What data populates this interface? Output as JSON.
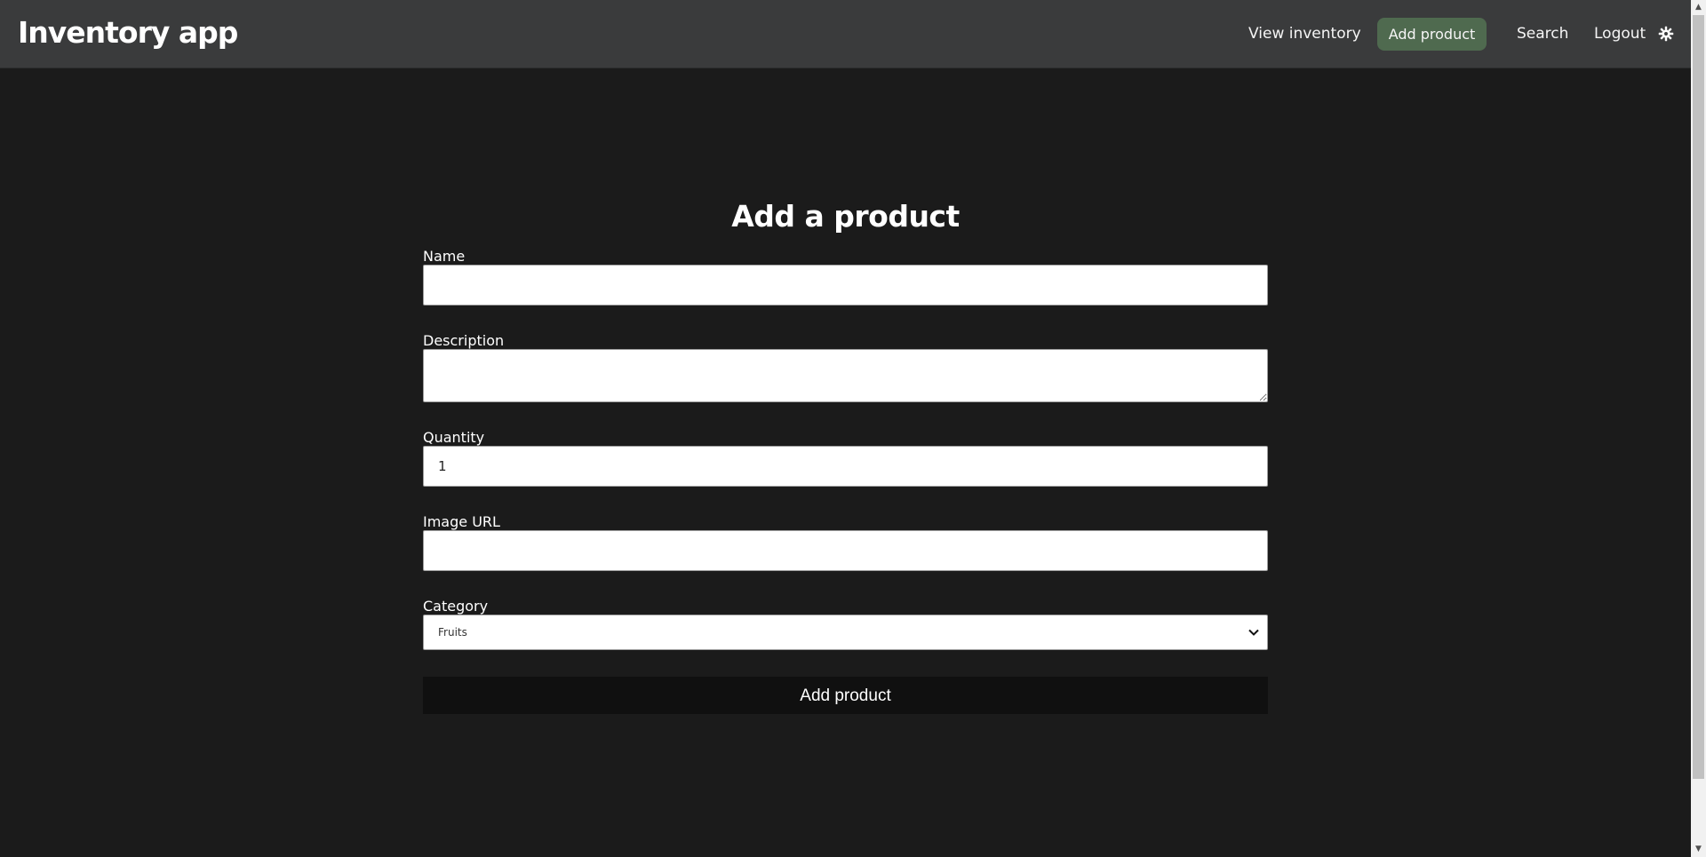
{
  "app": {
    "title": "Inventory app"
  },
  "nav": {
    "items": [
      {
        "label": "View inventory",
        "active": false
      },
      {
        "label": "Add product",
        "active": true
      },
      {
        "label": "Search",
        "active": false
      },
      {
        "label": "Logout",
        "active": false
      }
    ],
    "theme_icon": "gear-icon"
  },
  "form": {
    "title": "Add a product",
    "name": {
      "label": "Name",
      "value": ""
    },
    "description": {
      "label": "Description",
      "value": ""
    },
    "quantity": {
      "label": "Quantity",
      "value": "1"
    },
    "image_url": {
      "label": "Image URL",
      "value": ""
    },
    "category": {
      "label": "Category",
      "selected": "Fruits"
    },
    "submit_label": "Add product"
  },
  "colors": {
    "background": "#1b1b1b",
    "navbar": "#3a3b3c",
    "active_nav": "#4f6a4f",
    "submit_button": "#101010"
  }
}
